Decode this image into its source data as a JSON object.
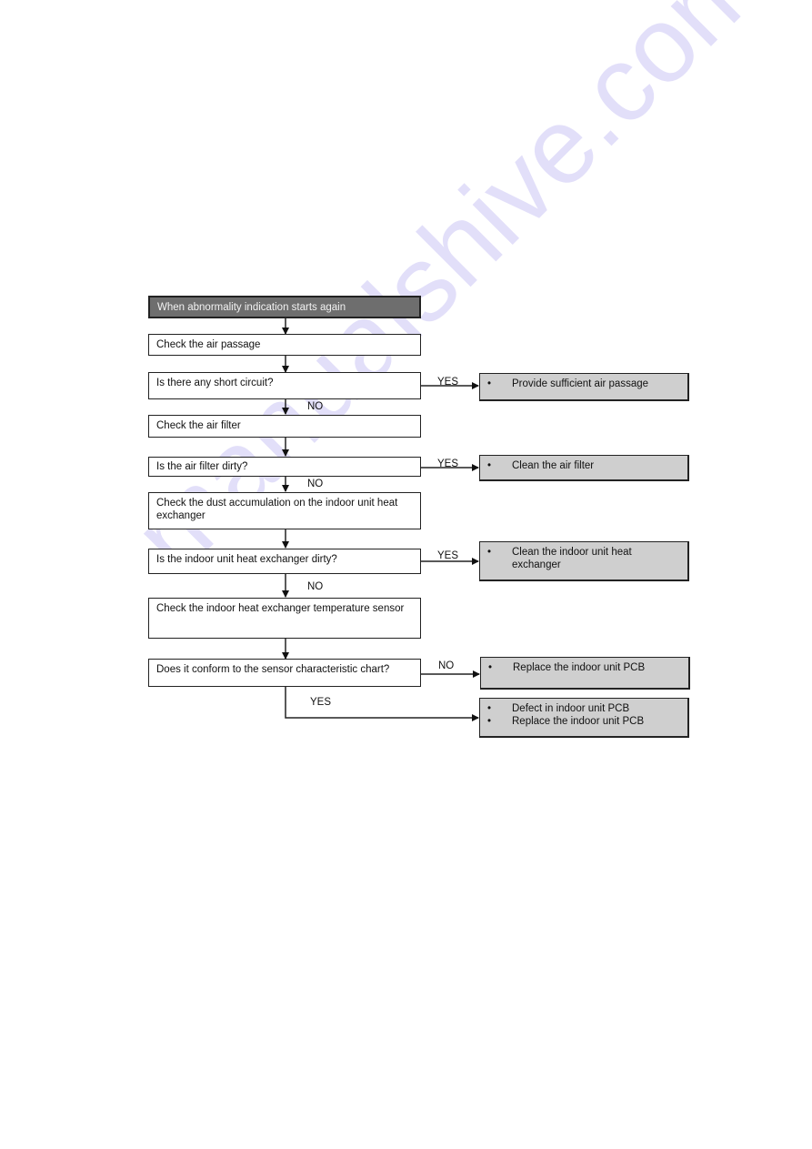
{
  "flowchart": {
    "start": "When abnormality indication starts again",
    "steps": [
      "Check the air passage",
      "Is there any short circuit?",
      "Check the air filter",
      "Is the air filter dirty?",
      "Check the dust accumulation on the indoor unit heat exchanger",
      "Is the indoor unit heat exchanger dirty?",
      "Check the indoor heat exchanger temperature sensor",
      "Does it conform to the sensor characteristic chart?"
    ],
    "results": [
      [
        "Provide sufficient air passage"
      ],
      [
        "Clean the air filter"
      ],
      [
        "Clean the indoor unit heat exchanger"
      ],
      [
        "Replace the indoor unit PCB"
      ],
      [
        "Defect in indoor unit PCB",
        "Replace the indoor unit PCB"
      ]
    ],
    "branch_labels": {
      "short_circuit_yes": "YES",
      "short_circuit_no": "NO",
      "filter_yes": "YES",
      "filter_no": "NO",
      "exchanger_yes": "YES",
      "exchanger_no": "NO",
      "sensor_no": "NO",
      "sensor_yes": "YES"
    }
  },
  "watermark": "manualshive.com"
}
